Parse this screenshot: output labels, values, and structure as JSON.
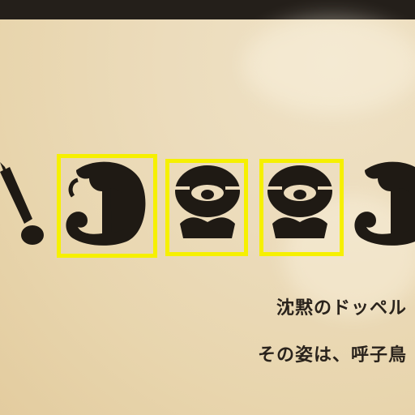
{
  "puzzle": {
    "glyphs": [
      {
        "id": "scepter",
        "icon": "scepter-glyph-icon",
        "selected": false
      },
      {
        "id": "curl-left",
        "icon": "curl-glyph-icon",
        "selected": true
      },
      {
        "id": "face-1",
        "icon": "face-glyph-icon",
        "selected": true
      },
      {
        "id": "face-2",
        "icon": "face-glyph-icon",
        "selected": true
      },
      {
        "id": "curl-right",
        "icon": "curl-glyph-icon",
        "selected": false
      }
    ],
    "highlight_color": "#f6f000",
    "ink_color": "#1f1a14"
  },
  "caption": {
    "line1": "沈黙のドッペル",
    "line2": "その姿は、呼子鳥"
  }
}
